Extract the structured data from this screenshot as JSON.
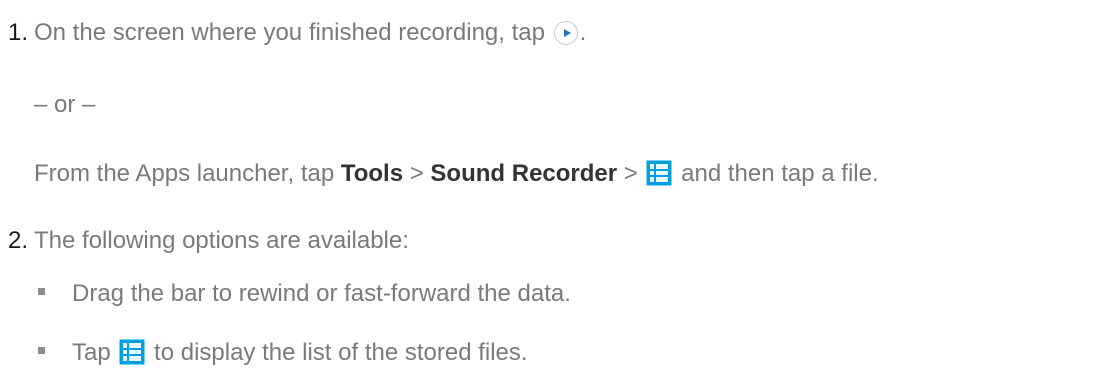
{
  "colors": {
    "text": "#7a7a7a",
    "number": "#1a1a1a",
    "bold": "#333333",
    "icon_accent": "#00a0e0",
    "play_accent": "#2a6fb5"
  },
  "steps": [
    {
      "number": "1.",
      "text_before_icon": "On the screen where you finished recording, tap",
      "icon": "play-icon",
      "text_after_icon": "."
    },
    {
      "number": "2.",
      "text": "The following options are available:"
    }
  ],
  "or_separator": "– or –",
  "alternative": {
    "prefix": "From the Apps launcher, tap ",
    "menu1": "Tools",
    "sep1": " > ",
    "menu2": "Sound Recorder",
    "sep2": " > ",
    "icon": "list-icon",
    "suffix": " and then tap a file."
  },
  "options": [
    {
      "text": "Drag the bar to rewind or fast-forward the data."
    },
    {
      "prefix": "Tap ",
      "icon": "list-icon",
      "suffix": " to display the list of the stored files."
    }
  ]
}
